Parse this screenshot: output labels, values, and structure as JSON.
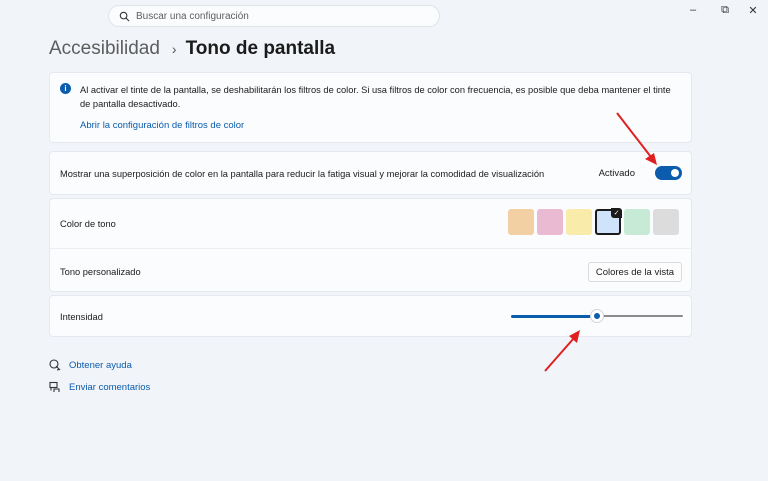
{
  "search": {
    "placeholder": "Buscar una configuración"
  },
  "window_controls": {
    "minimize": "–",
    "restore": "⧉",
    "close": "✕"
  },
  "breadcrumb": {
    "parent": "Accesibilidad",
    "separator": "›",
    "current": "Tono de pantalla"
  },
  "info": {
    "icon": "info-icon",
    "text": "Al activar el tinte de la pantalla, se deshabilitarán los filtros de color. Si usa filtros de color con frecuencia, es posible que deba mantener el tinte de pantalla desactivado.",
    "link": "Abrir la configuración de filtros de color"
  },
  "overlay": {
    "label": "Mostrar una superposición de color en la pantalla para reducir la fatiga visual y mejorar la comodidad de visualización",
    "status": "Activado",
    "on": true
  },
  "tone": {
    "label": "Color de tono",
    "swatches": [
      "#f3cfa4",
      "#eab9d2",
      "#f9ecab",
      "#cfe3fb",
      "#c7ead6",
      "#dcdcdc"
    ],
    "selected_index": 3
  },
  "custom": {
    "label": "Tono personalizado",
    "button": "Colores de la vista"
  },
  "intensity": {
    "label": "Intensidad",
    "value_fraction": 0.5
  },
  "links": {
    "help": "Obtener ayuda",
    "feedback": "Enviar comentarios"
  },
  "colors": {
    "accent": "#0b5cad",
    "annotation_arrow": "#e02020"
  }
}
